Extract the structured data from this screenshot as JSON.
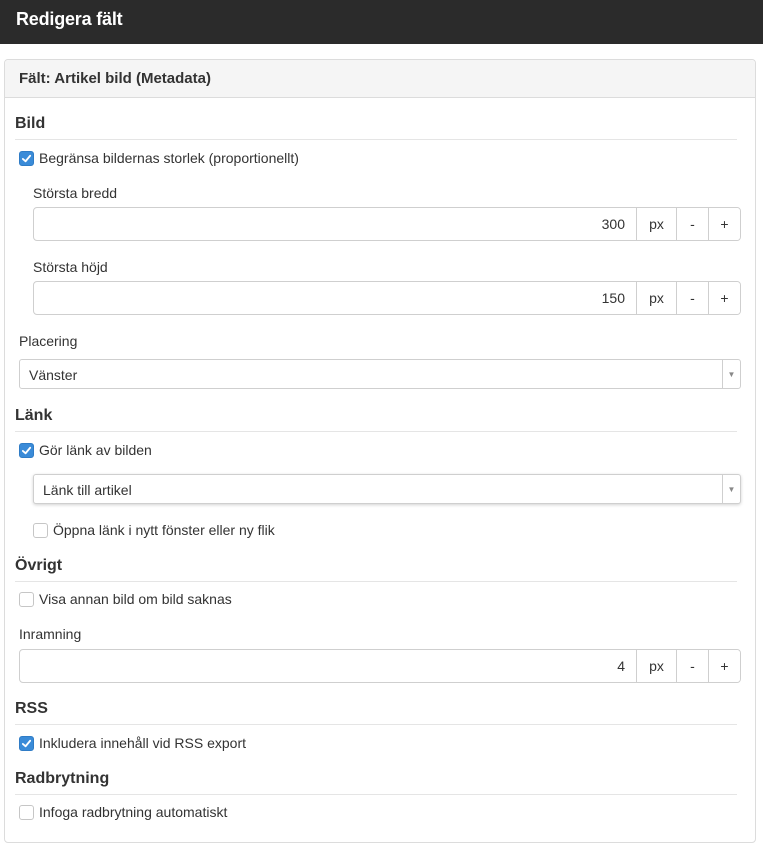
{
  "window": {
    "title": "Redigera fält"
  },
  "panel": {
    "heading": "Fält: Artikel bild (Metadata)"
  },
  "sections": {
    "bild": {
      "title": "Bild",
      "limit_size": {
        "label": "Begränsa bildernas storlek (proportionellt)",
        "checked": true
      },
      "max_width": {
        "label": "Största bredd",
        "value": "300",
        "unit": "px",
        "minus": "-",
        "plus": "+"
      },
      "max_height": {
        "label": "Största höjd",
        "value": "150",
        "unit": "px",
        "minus": "-",
        "plus": "+"
      },
      "placement": {
        "label": "Placering",
        "value": "Vänster"
      }
    },
    "lank": {
      "title": "Länk",
      "make_link": {
        "label": "Gör länk av bilden",
        "checked": true
      },
      "link_target": {
        "value": "Länk till artikel"
      },
      "new_window": {
        "label": "Öppna länk i nytt fönster eller ny flik",
        "checked": false
      }
    },
    "ovrigt": {
      "title": "Övrigt",
      "alt_image": {
        "label": "Visa annan bild om bild saknas",
        "checked": false
      },
      "frame": {
        "label": "Inramning",
        "value": "4",
        "unit": "px",
        "minus": "-",
        "plus": "+"
      }
    },
    "rss": {
      "title": "RSS",
      "include": {
        "label": "Inkludera innehåll vid RSS export",
        "checked": true
      }
    },
    "radbrytning": {
      "title": "Radbrytning",
      "auto": {
        "label": "Infoga radbrytning automatiskt",
        "checked": false
      }
    }
  },
  "icons": {
    "check": "check-icon",
    "dropdown": "caret-down-icon"
  },
  "colors": {
    "titlebar": "#2b2b2b",
    "checkbox_checked": "#3a8bd8"
  }
}
